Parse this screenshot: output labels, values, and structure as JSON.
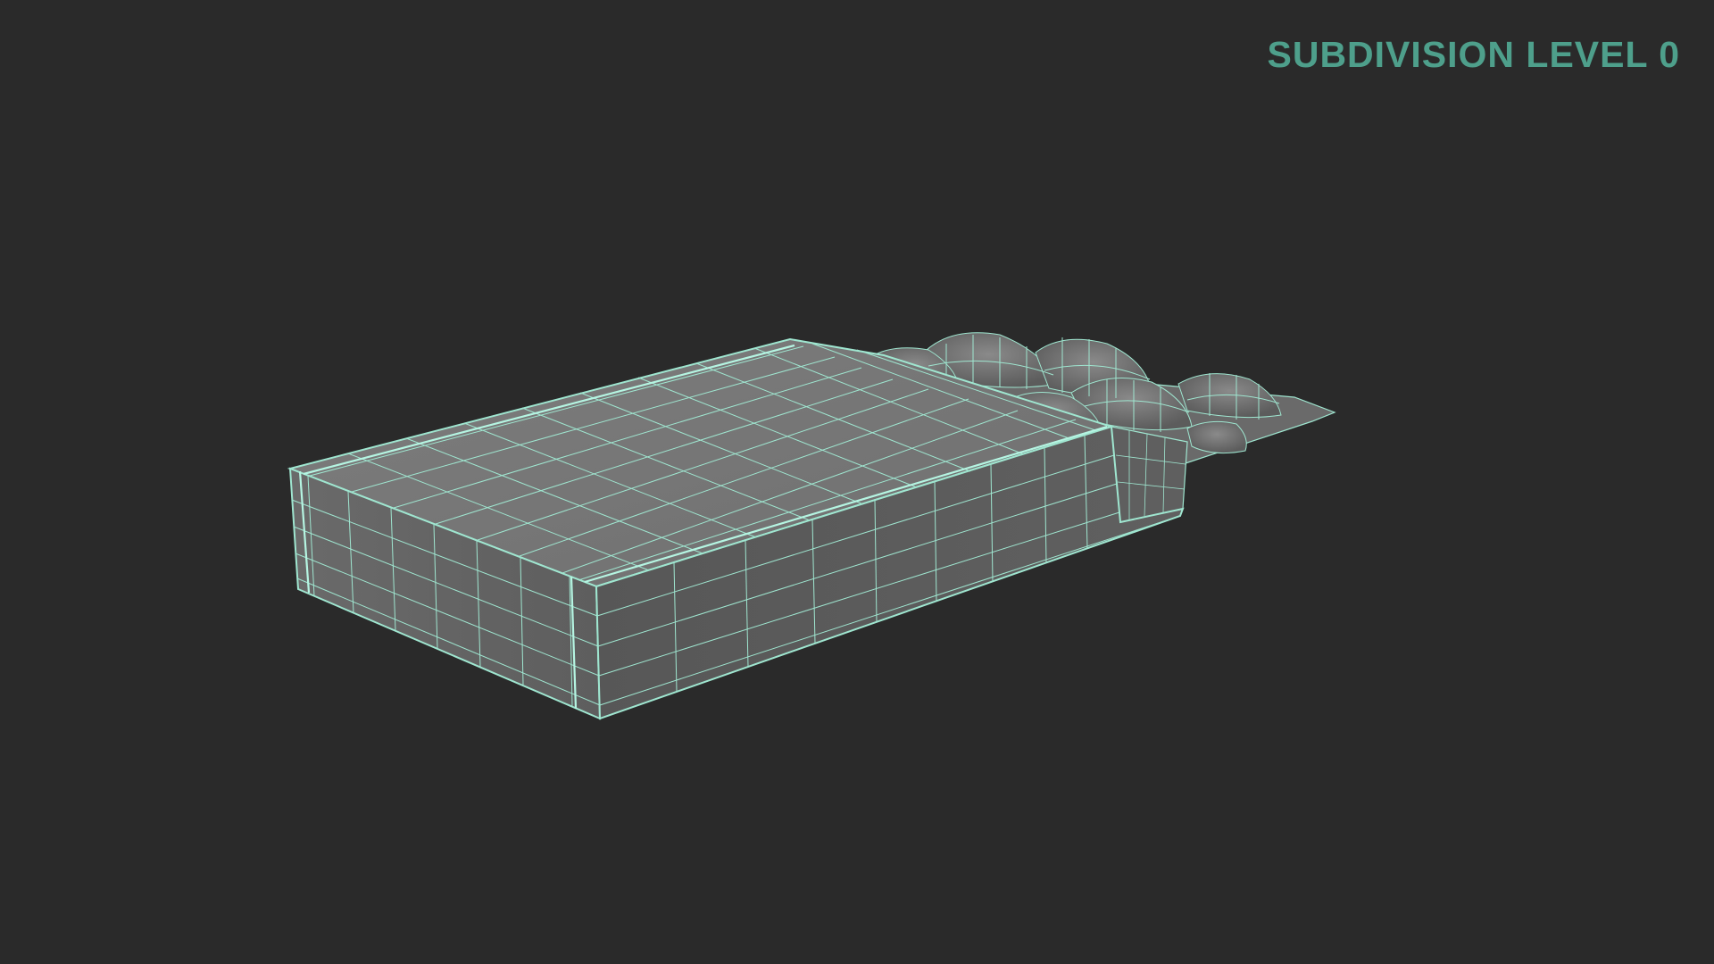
{
  "overlay": {
    "label": "SUBDIVISION LEVEL 0"
  },
  "colors": {
    "background": "#2a2a2a",
    "label": "#4e9f8b",
    "wire": "#9fe6d0",
    "top_face": "#7a7a7a",
    "side_face": "#5a5a5a",
    "end_face": "#686868"
  },
  "model": {
    "icon": "wireframe-blister-pack"
  }
}
